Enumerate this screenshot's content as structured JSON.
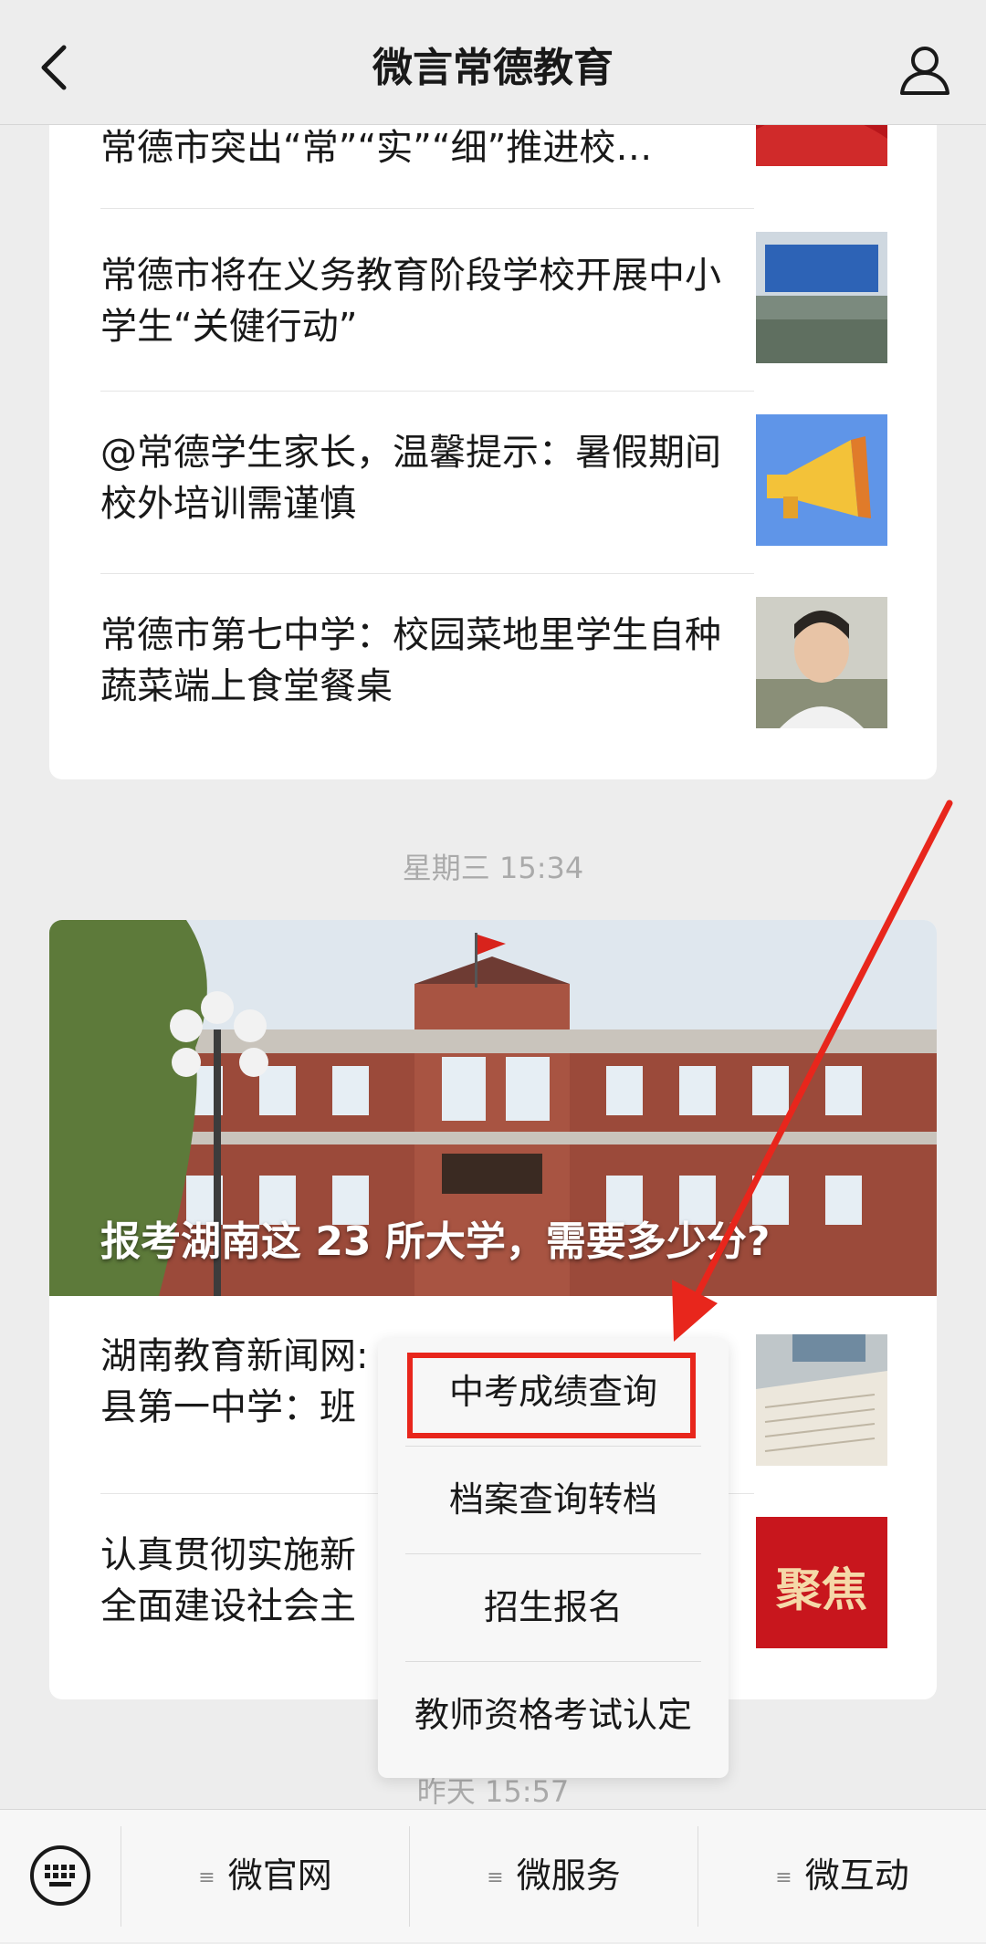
{
  "header": {
    "title": "微言常德教育"
  },
  "card1": {
    "items": [
      {
        "title": "常德市突出“常”“实”“细”推进校…"
      },
      {
        "title": "常德市将在义务教育阶段学校开展中小学生“关健行动”"
      },
      {
        "title": "@常德学生家长，温馨提示：暑假期间校外培训需谨慎"
      },
      {
        "title": "常德市第七中学：校园菜地里学生自种蔬菜端上食堂餐桌"
      }
    ]
  },
  "timestamps": {
    "wed": "星期三 15:34",
    "yesterday": "昨天 15:57"
  },
  "card2": {
    "hero_title": "报考湖南这 23 所大学，需要多少分?",
    "items": [
      {
        "title": "湖南教育新闻网:\n县第一中学：班"
      },
      {
        "title": "认真贯彻实施新\n全面建设社会主"
      }
    ],
    "thumb2_text": "聚焦"
  },
  "popup_menu": {
    "items": [
      "中考成绩查询",
      "档案查询转档",
      "招生报名",
      "教师资格考试认定"
    ]
  },
  "bottom_bar": {
    "buttons": [
      "微官网",
      "微服务",
      "微互动"
    ]
  },
  "colors": {
    "accent_red": "#e8261c"
  },
  "icons": [
    "back-icon",
    "user-icon",
    "keyboard-icon",
    "menu-lines-icon"
  ]
}
